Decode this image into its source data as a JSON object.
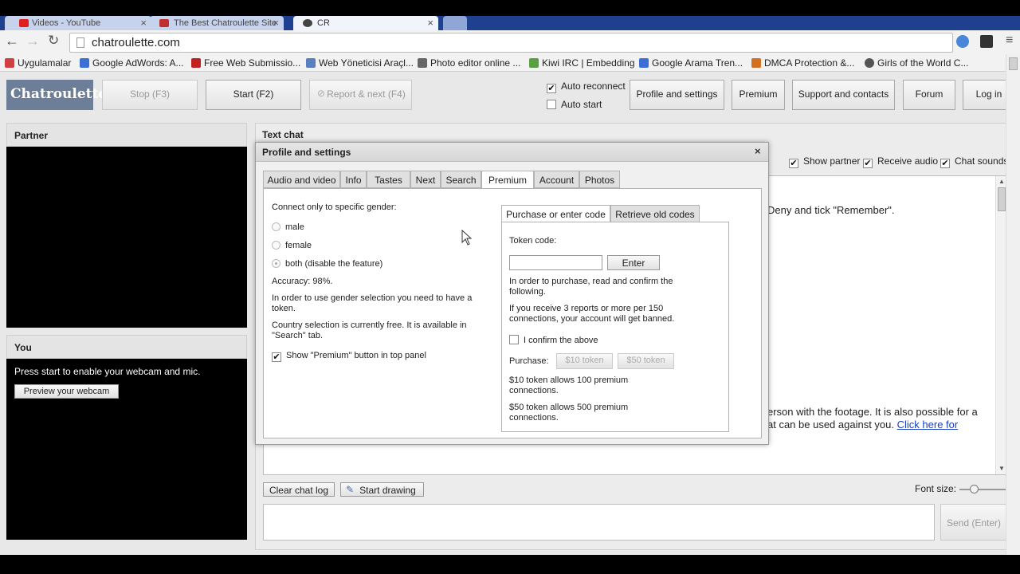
{
  "browser": {
    "tabs": [
      {
        "title": "Videos - YouTube",
        "favicon_color": "#e02020"
      },
      {
        "title": "The Best Chatroulette Site",
        "favicon_color": "#c03030"
      },
      {
        "title": "CR",
        "favicon_color": "#444444"
      }
    ],
    "url": "chatroulette.com",
    "bookmarks": [
      {
        "label": "Uygulamalar",
        "icon_color": "#d04040"
      },
      {
        "label": "Google AdWords: A...",
        "icon_color": "#3b6fd6"
      },
      {
        "label": "Free Web Submissio...",
        "icon_color": "#c02020"
      },
      {
        "label": "Web Yöneticisi Araçl...",
        "icon_color": "#5a7fbf"
      },
      {
        "label": "Photo editor online ...",
        "icon_color": "#666666"
      },
      {
        "label": "Kiwi IRC | Embedding",
        "icon_color": "#5aa040"
      },
      {
        "label": "Google Arama Tren...",
        "icon_color": "#3b6fd6"
      },
      {
        "label": "DMCA Protection &...",
        "icon_color": "#d07020"
      },
      {
        "label": "Girls of the World C...",
        "icon_color": "#555555"
      }
    ]
  },
  "header": {
    "logo": "Chatroulette",
    "stop_label": "Stop (F3)",
    "start_label": "Start (F2)",
    "report_label": "Report & next (F4)",
    "auto_reconnect": "Auto reconnect",
    "auto_start": "Auto start",
    "nav": [
      "Profile and settings",
      "Premium",
      "Support and contacts",
      "Forum",
      "Log in"
    ]
  },
  "left": {
    "partner_title": "Partner",
    "you_title": "You",
    "you_text": "Press start to enable your webcam and mic.",
    "preview_button": "Preview your webcam"
  },
  "chat": {
    "title": "Text chat",
    "options": [
      "Show partner",
      "Receive audio",
      "Chat sounds"
    ],
    "text_line1": "Deny and tick \"Remember\".",
    "text_line2": "erson with the footage. It is also possible for a",
    "text_line3": "at can be used against you.",
    "text_link": "Click here for",
    "clear_button": "Clear chat log",
    "draw_button": "Start drawing",
    "font_size_label": "Font size:",
    "font_size_level": 0.3,
    "send_button": "Send (Enter)"
  },
  "modal": {
    "title": "Profile and settings",
    "tabs": [
      "Audio and video",
      "Info",
      "Tastes",
      "Next",
      "Search",
      "Premium",
      "Account",
      "Photos"
    ],
    "active_tab": "Premium",
    "gender_heading": "Connect only to specific gender:",
    "gender_options": [
      "male",
      "female",
      "both (disable the feature)"
    ],
    "accuracy": "Accuracy: 98%.",
    "gender_note": "In order to use gender selection you need to have a token.",
    "country_note": "Country selection is currently free. It is available in \"Search\" tab.",
    "show_premium": "Show \"Premium\" button in top panel",
    "subtabs": [
      "Purchase or enter code",
      "Retrieve old codes"
    ],
    "token_label": "Token code:",
    "enter_button": "Enter",
    "purchase_note": "In order to purchase, read and confirm the following.",
    "reports_note": "If you receive 3 reports or more per 150 connections, your account will get banned.",
    "confirm_label": "I confirm the above",
    "purchase_label": "Purchase:",
    "token10": "$10 token",
    "token50": "$50 token",
    "token10_note": "$10 token allows 100 premium connections.",
    "token50_note": "$50 token allows 500 premium connections."
  }
}
